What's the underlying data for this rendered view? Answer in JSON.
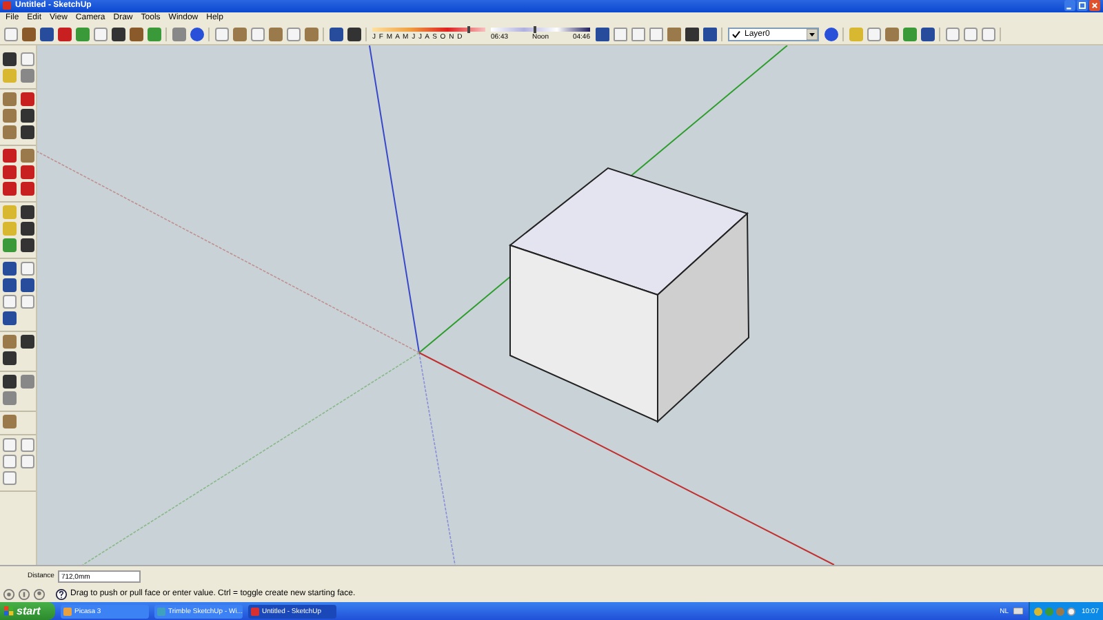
{
  "window": {
    "title": "Untitled - SketchUp"
  },
  "menu": [
    "File",
    "Edit",
    "View",
    "Camera",
    "Draw",
    "Tools",
    "Window",
    "Help"
  ],
  "shadow_settings": {
    "month_slider": {
      "scale": "J F M A M J J A S O N D",
      "level": 0.85
    },
    "time_slider": {
      "times": [
        "06:43",
        "Noon",
        "04:46"
      ],
      "level": 0.45
    }
  },
  "layer_dropdown": {
    "value": "Layer0"
  },
  "measurements": {
    "label": "Distance",
    "value": "712,0mm"
  },
  "status_bar": {
    "message": "Drag to push or pull face or enter value.  Ctrl = toggle create new starting face."
  },
  "taskbar": {
    "start": "start",
    "tasks": [
      {
        "label": "Picasa 3",
        "selected": false
      },
      {
        "label": "Trimble SketchUp - Wi...",
        "selected": false
      },
      {
        "label": "Untitled - SketchUp",
        "selected": true
      }
    ],
    "language": "NL",
    "clock": "10:07"
  }
}
